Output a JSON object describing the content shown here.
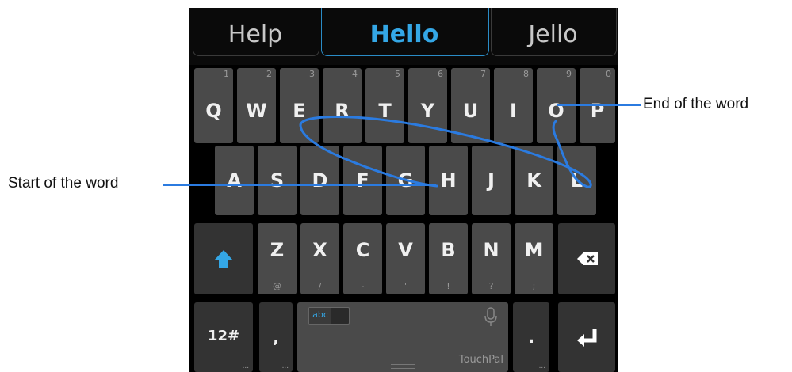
{
  "suggestions": {
    "left": "Help",
    "center": "Hello",
    "right": "Jello"
  },
  "rows": {
    "row1": [
      {
        "key": "Q",
        "hint": "1"
      },
      {
        "key": "W",
        "hint": "2"
      },
      {
        "key": "E",
        "hint": "3"
      },
      {
        "key": "R",
        "hint": "4"
      },
      {
        "key": "T",
        "hint": "5"
      },
      {
        "key": "Y",
        "hint": "6"
      },
      {
        "key": "U",
        "hint": "7"
      },
      {
        "key": "I",
        "hint": "8"
      },
      {
        "key": "O",
        "hint": "9"
      },
      {
        "key": "P",
        "hint": "0"
      }
    ],
    "row2": [
      "A",
      "S",
      "D",
      "F",
      "G",
      "H",
      "J",
      "K",
      "L"
    ],
    "row3": [
      {
        "key": "Z",
        "sub": "@"
      },
      {
        "key": "X",
        "sub": "/"
      },
      {
        "key": "C",
        "sub": "-"
      },
      {
        "key": "V",
        "sub": "'"
      },
      {
        "key": "B",
        "sub": "!"
      },
      {
        "key": "N",
        "sub": "?"
      },
      {
        "key": "M",
        "sub": ";"
      }
    ]
  },
  "bottom": {
    "symbols_label": "12#",
    "comma_label": ",",
    "language_toggle": "abc",
    "space_brand": "TouchPal",
    "period_label": "."
  },
  "dots": "...",
  "icons": {
    "shift": "shift-arrow-up-icon",
    "delete": "backspace-x-icon",
    "enter": "enter-return-arrow-icon",
    "mic": "microphone-icon"
  },
  "annotations": {
    "start": "Start of the word",
    "end": "End of the word"
  },
  "colors": {
    "accent": "#34a7e6",
    "trace": "#2b7be0"
  }
}
